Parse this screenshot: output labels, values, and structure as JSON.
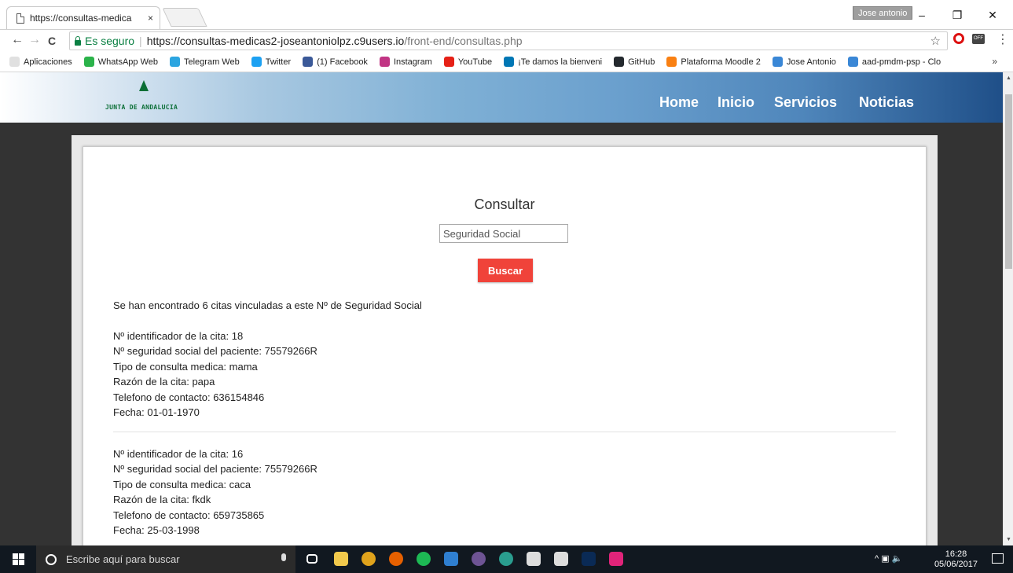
{
  "browser": {
    "tab_title": "https://consultas-medica",
    "tab_close": "×",
    "profile_name": "Jose antonio",
    "window_controls": {
      "minimize": "–",
      "maximize": "❐",
      "close": "✕"
    },
    "nav": {
      "back": "←",
      "forward": "→",
      "reload": "C"
    },
    "secure_label": "Es seguro",
    "separator": "|",
    "url_host": "https://consultas-medicas2-joseantoniolpz.c9users.io",
    "url_path": "/front-end/consultas.php",
    "star": "☆",
    "ext_label": "OFF",
    "menu": "⋮"
  },
  "bookmarks": {
    "items": [
      {
        "label": "Aplicaciones",
        "color": "#e0e0e0"
      },
      {
        "label": "WhatsApp Web",
        "color": "#2bb34a"
      },
      {
        "label": "Telegram Web",
        "color": "#2ca5e0"
      },
      {
        "label": "Twitter",
        "color": "#1da1f2"
      },
      {
        "label": "(1) Facebook",
        "color": "#3b5998"
      },
      {
        "label": "Instagram",
        "color": "#c13584"
      },
      {
        "label": "YouTube",
        "color": "#e62117"
      },
      {
        "label": "¡Te damos la bienveni",
        "color": "#0077b5"
      },
      {
        "label": "GitHub",
        "color": "#24292e"
      },
      {
        "label": "Plataforma Moodle 2",
        "color": "#f98012"
      },
      {
        "label": "Jose Antonio",
        "color": "#3a87d6"
      },
      {
        "label": "aad-pmdm-psp - Clo",
        "color": "#3a87d6"
      }
    ],
    "more": "»"
  },
  "site": {
    "logo_text": "JUNTA DE ANDALUCIA",
    "nav": [
      "Home",
      "Inicio",
      "Servicios",
      "Noticias"
    ]
  },
  "consultar": {
    "heading": "Consultar",
    "input_placeholder": "Seguridad Social",
    "button_label": "Buscar",
    "summary": "Se han encontrado 6 citas vinculadas a este Nº de Seguridad Social",
    "citas": [
      {
        "id": "Nº identificador de la cita: 18",
        "ss": "Nº seguridad social del paciente: 75579266R",
        "tipo": "Tipo de consulta medica: mama",
        "razon": "Razón de la cita: papa",
        "telefono": "Telefono de contacto: 636154846",
        "fecha": "Fecha: 01-01-1970"
      },
      {
        "id": "Nº identificador de la cita: 16",
        "ss": "Nº seguridad social del paciente: 75579266R",
        "tipo": "Tipo de consulta medica: caca",
        "razon": "Razón de la cita: fkdk",
        "telefono": "Telefono de contacto: 659735865",
        "fecha": "Fecha: 25-03-1998"
      }
    ]
  },
  "taskbar": {
    "search_placeholder": "Escribe aquí para buscar",
    "time": "16:28",
    "date": "05/06/2017",
    "apps": [
      {
        "name": "task-view",
        "color": "#ffffff"
      },
      {
        "name": "file-explorer",
        "color": "#f2c94c"
      },
      {
        "name": "chrome",
        "color": "#e0a31c"
      },
      {
        "name": "firefox",
        "color": "#e66000"
      },
      {
        "name": "spotify",
        "color": "#1db954"
      },
      {
        "name": "virtualbox-box",
        "color": "#2f7fd0"
      },
      {
        "name": "github-desktop",
        "color": "#6e5494"
      },
      {
        "name": "gitkraken",
        "color": "#2a9d8f"
      },
      {
        "name": "visual-studio",
        "color": "#dddddd"
      },
      {
        "name": "unity",
        "color": "#dddddd"
      },
      {
        "name": "photoshop",
        "color": "#0a2a55"
      },
      {
        "name": "wamp",
        "color": "#e0247a"
      }
    ]
  }
}
